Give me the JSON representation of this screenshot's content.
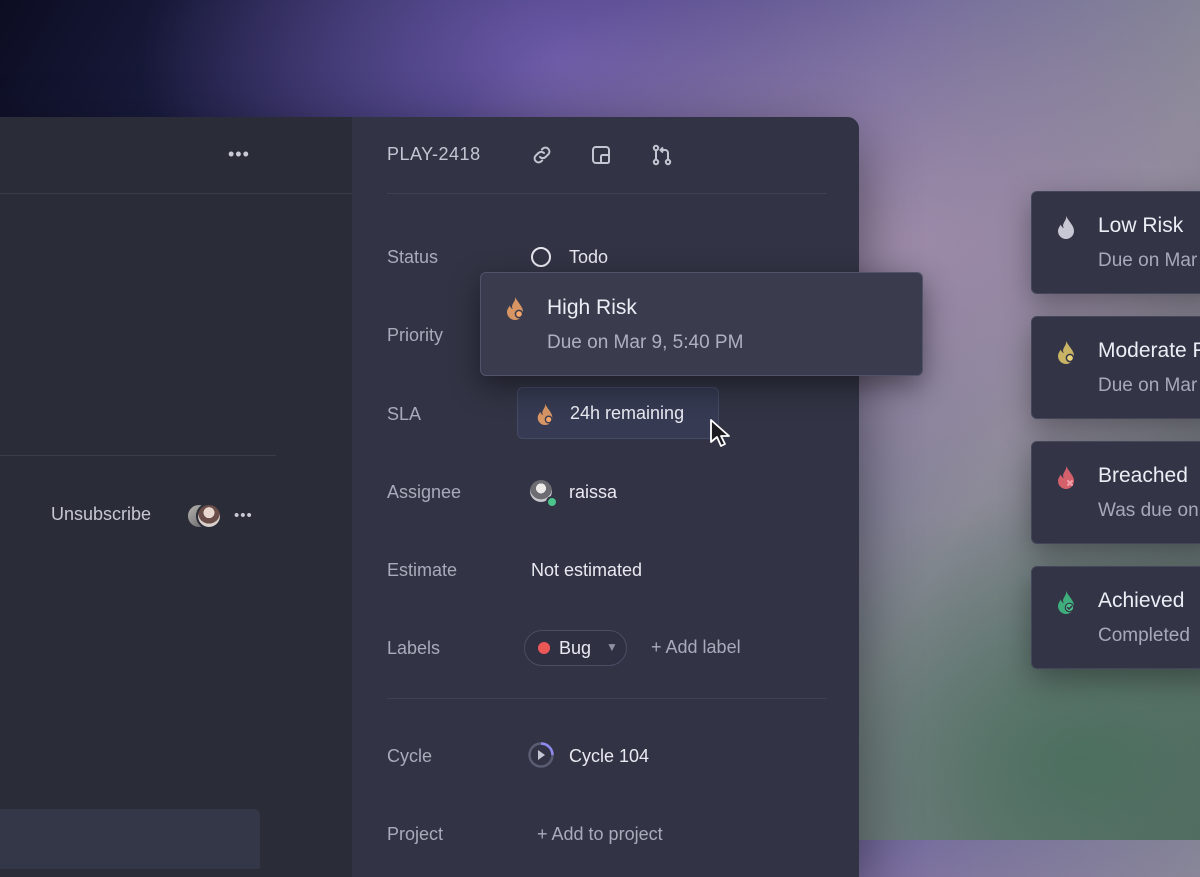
{
  "issue": {
    "id": "PLAY-2418"
  },
  "properties": {
    "status_label": "Status",
    "status_value": "Todo",
    "priority_label": "Priority",
    "sla_label": "SLA",
    "sla_value": "24h remaining",
    "assignee_label": "Assignee",
    "assignee_value": "raissa",
    "estimate_label": "Estimate",
    "estimate_value": "Not estimated",
    "labels_label": "Labels",
    "label_bug": "Bug",
    "add_label": "+ Add label",
    "cycle_label": "Cycle",
    "cycle_value": "Cycle 104",
    "project_label": "Project",
    "add_project": "+ Add to project"
  },
  "activity": {
    "unsubscribe": "Unsubscribe"
  },
  "tooltip": {
    "title": "High Risk",
    "subtitle": "Due on Mar 9, 5:40 PM"
  },
  "sla_cards": [
    {
      "title": "Low Risk",
      "subtitle": "Due on Mar",
      "icon": "flame-icon",
      "color": "#c7c8d4"
    },
    {
      "title": "Moderate Risk",
      "subtitle": "Due on Mar",
      "icon": "flame-moderate-icon",
      "color": "#d8c36a"
    },
    {
      "title": "Breached",
      "subtitle": "Was due on",
      "icon": "flame-breached-icon",
      "color": "#e0707a"
    },
    {
      "title": "Achieved",
      "subtitle": "Completed",
      "icon": "flame-achieved-icon",
      "color": "#4cc38a"
    }
  ],
  "colors": {
    "high_risk": "#e0986a",
    "bug": "#eb5757",
    "online": "#4cc38a",
    "cycle": "#8e8bf0"
  }
}
